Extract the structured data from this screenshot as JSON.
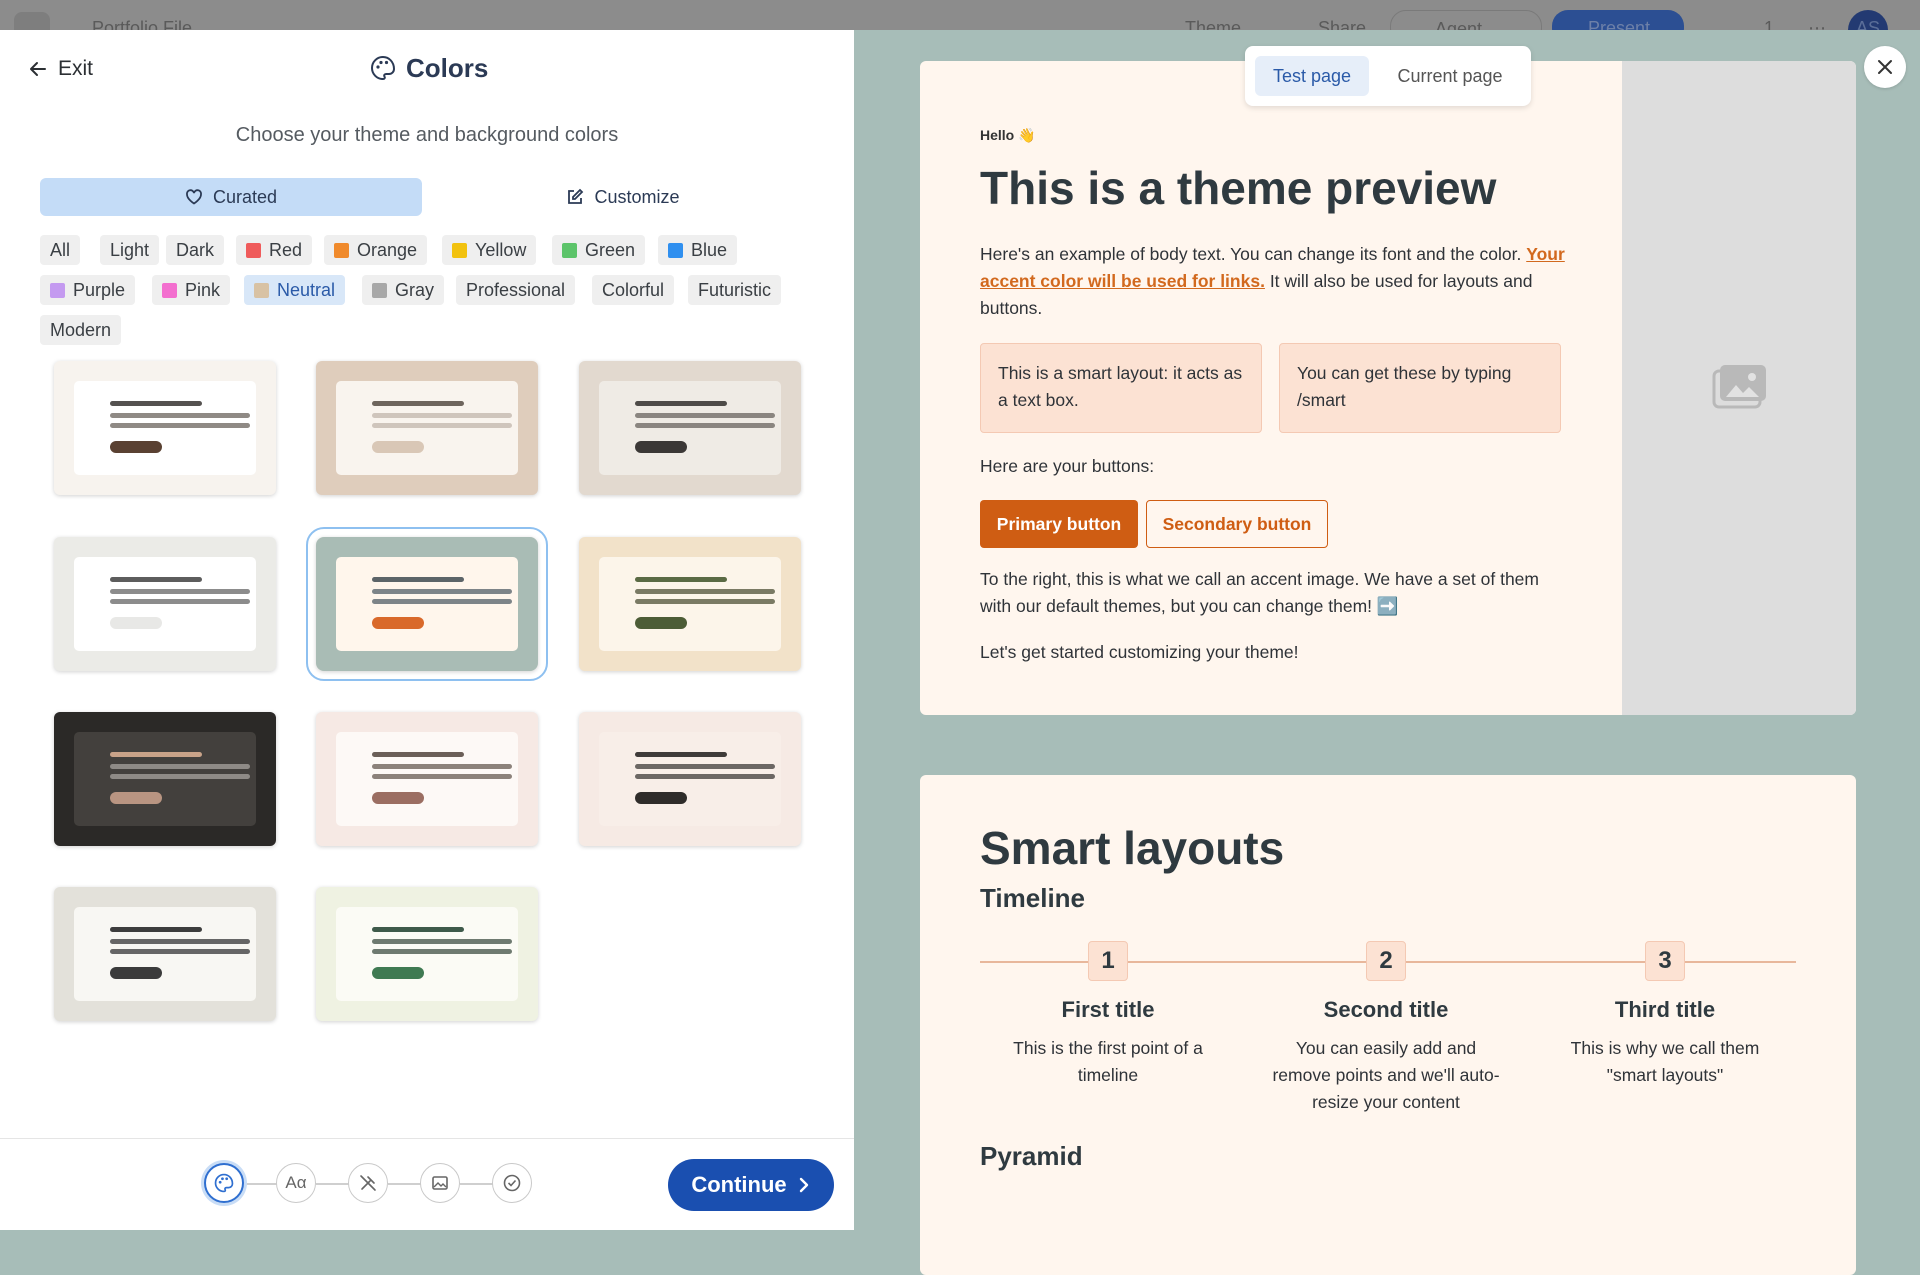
{
  "appbar": {
    "doc_title": "Portfolio File",
    "theme_label": "Theme",
    "share_label": "Share",
    "agent_label": "Agent",
    "present_label": "Present",
    "comment_count": "1",
    "avatar_initials": "AS"
  },
  "panel": {
    "exit_label": "Exit",
    "title": "Colors",
    "subtitle": "Choose your theme and background colors",
    "tabs": {
      "curated": "Curated",
      "customize": "Customize"
    },
    "filters": [
      {
        "label": "All",
        "swatch": ""
      },
      {
        "label": "Light",
        "swatch": ""
      },
      {
        "label": "Dark",
        "swatch": ""
      },
      {
        "label": "Red",
        "swatch": "#ef5b5b"
      },
      {
        "label": "Orange",
        "swatch": "#f08a2c"
      },
      {
        "label": "Yellow",
        "swatch": "#f2c20f"
      },
      {
        "label": "Green",
        "swatch": "#5cc46a"
      },
      {
        "label": "Blue",
        "swatch": "#2f8fef"
      },
      {
        "label": "Purple",
        "swatch": "#c49af0"
      },
      {
        "label": "Pink",
        "swatch": "#f36fcf"
      },
      {
        "label": "Neutral",
        "swatch": "#d8c2a4",
        "selected": true
      },
      {
        "label": "Gray",
        "swatch": "#a8a8a8"
      },
      {
        "label": "Professional",
        "swatch": ""
      },
      {
        "label": "Colorful",
        "swatch": ""
      },
      {
        "label": "Futuristic",
        "swatch": ""
      },
      {
        "label": "Modern",
        "swatch": ""
      }
    ],
    "themes": [
      {
        "bg": "#f7f3ee",
        "inner": "#ffffff",
        "l1": "#555250",
        "l2": "#8f8a85",
        "btn": "#5a4132"
      },
      {
        "bg": "#dfcdbc",
        "inner": "#f9f4ee",
        "l1": "#6e655d",
        "l2": "#cfc5bc",
        "btn": "#d9c7b6"
      },
      {
        "bg": "#e2d9cf",
        "inner": "#efebe5",
        "l1": "#4e4b48",
        "l2": "#8a8580",
        "btn": "#3b3836"
      },
      {
        "bg": "#ebebe7",
        "inner": "#ffffff",
        "l1": "#5d5d5d",
        "l2": "#8c8c8c",
        "btn": "#e8e8e6"
      },
      {
        "bg": "#a9bcb5",
        "inner": "#fff6ec",
        "l1": "#5c6468",
        "l2": "#7d8488",
        "btn": "#d9692a",
        "selected": true
      },
      {
        "bg": "#f2e2c9",
        "inner": "#fcf5ea",
        "l1": "#5a6a44",
        "l2": "#7a7a64",
        "btn": "#4c5c36"
      },
      {
        "bg": "#2b2927",
        "inner": "#43403d",
        "l1": "#c9a389",
        "l2": "#8e8a86",
        "btn": "#b99582"
      },
      {
        "bg": "#f6e9e4",
        "inner": "#fdf9f6",
        "l1": "#6b5f58",
        "l2": "#8c827b",
        "btn": "#9b6e62"
      },
      {
        "bg": "#f6eae4",
        "inner": "#f8eee8",
        "l1": "#3f3b39",
        "l2": "#6c6764",
        "btn": "#2f2c2a"
      },
      {
        "bg": "#e3e1da",
        "inner": "#f8f7f3",
        "l1": "#3d3d3d",
        "l2": "#666",
        "btn": "#3b3b3b"
      },
      {
        "bg": "#eff2e2",
        "inner": "#fbfbf5",
        "l1": "#3e5a4a",
        "l2": "#6e7a70",
        "btn": "#3f7a52"
      }
    ],
    "steps": [
      "palette-icon",
      "font-icon",
      "brush-icon",
      "image-icon",
      "check-icon"
    ],
    "continue_label": "Continue"
  },
  "preview": {
    "toggle": {
      "test": "Test page",
      "current": "Current page"
    },
    "slide1": {
      "hello": "Hello 👋",
      "title": "This is a theme preview",
      "body_1": "Here's an example of body text. You can change its font and the color.",
      "link": "Your accent color will be used for links.",
      "body_2": " It will also be used for layouts and buttons.",
      "smart_1": "This is a smart layout: it acts as a text box.",
      "smart_2": "You can get these by typing /smart",
      "buttons_intro": "Here are your buttons:",
      "primary": "Primary button",
      "secondary": "Secondary button",
      "accent_text": "To the right, this is what we call an accent image. We have a set of them with our default themes, but you can change them! ➡️",
      "closing": "Let's get started customizing your theme!"
    },
    "slide2": {
      "title": "Smart layouts",
      "subtitle": "Timeline",
      "items": [
        {
          "num": "1",
          "title": "First title",
          "desc": "This is the first point of a timeline"
        },
        {
          "num": "2",
          "title": "Second title",
          "desc": "You can easily add and remove points and we'll auto-resize your content"
        },
        {
          "num": "3",
          "title": "Third title",
          "desc": "This is why we call them \"smart layouts\""
        }
      ],
      "next_heading": "Pyramid"
    }
  }
}
